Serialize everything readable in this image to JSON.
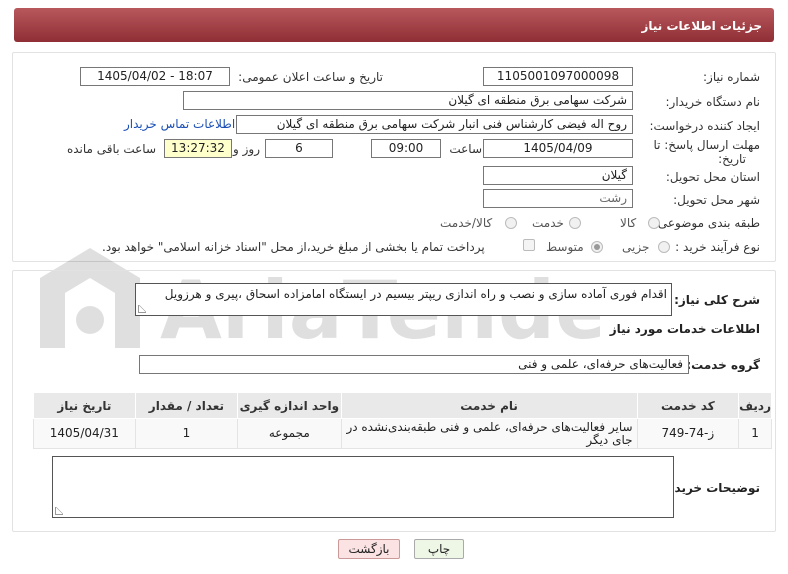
{
  "header": {
    "title": "جزئیات اطلاعات نیاز"
  },
  "form": {
    "need_number_label": "شماره نیاز:",
    "need_number": "1105001097000098",
    "announce_label": "تاریخ و ساعت اعلان عمومی:",
    "announce_value": "1405/04/02 - 18:07",
    "buyer_org_label": "نام دستگاه خریدار:",
    "buyer_org": "شرکت سهامی برق منطقه ای گیلان",
    "creator_label": "ایجاد کننده درخواست:",
    "creator": "روح اله فیضی کارشناس فنی انبار شرکت سهامی برق منطقه ای گیلان",
    "contact_link": "اطلاعات تماس خریدار",
    "deadline_label_1": "مهلت ارسال پاسخ: تا",
    "deadline_label_2": "تاریخ:",
    "deadline_date": "1405/04/09",
    "time_label": "ساعت",
    "deadline_time": "09:00",
    "days": "6",
    "days_label": "روز و",
    "remaining_time": "13:27:32",
    "remaining_label": "ساعت باقی مانده",
    "province_label": "استان محل تحویل:",
    "province": "گیلان",
    "city_label": "شهر محل تحویل:",
    "city": "رشت",
    "category_label": "طبقه بندی موضوعی:",
    "category_options": [
      "کالا",
      "خدمت",
      "کالا/خدمت"
    ],
    "category_selected": "خدمت",
    "process_label": "نوع فرآیند خرید :",
    "process_options": [
      "جزیی",
      "متوسط"
    ],
    "process_selected": "متوسط",
    "payment_note": "پرداخت تمام یا بخشی از مبلغ خرید،از محل \"اسناد خزانه اسلامی\" خواهد بود."
  },
  "description": {
    "label": "شرح کلی نیاز:",
    "text": "اقدام فوری آماده سازی و نصب و راه اندازی ریپتر بیسیم در ایستگاه امامزاده اسحاق ،پیری و هرزویل"
  },
  "services": {
    "section_title": "اطلاعات خدمات مورد نیاز",
    "group_label": "گروه خدمت:",
    "group_value": "فعالیت‌های حرفه‌ای، علمی و فنی",
    "columns": [
      "ردیف",
      "کد خدمت",
      "نام خدمت",
      "واحد اندازه گیری",
      "تعداد / مقدار",
      "تاریخ نیاز"
    ],
    "rows": [
      [
        "1",
        "ز-74-749",
        "سایر فعالیت‌های حرفه‌ای، علمی و فنی طبقه‌بندی‌نشده در جای دیگر",
        "مجموعه",
        "1",
        "1405/04/31"
      ]
    ]
  },
  "buyer_notes": {
    "label": "توضیحات خریدار:",
    "text": ""
  },
  "buttons": {
    "print": "چاپ",
    "back": "بازگشت"
  },
  "watermark": "AriaTender.net"
}
